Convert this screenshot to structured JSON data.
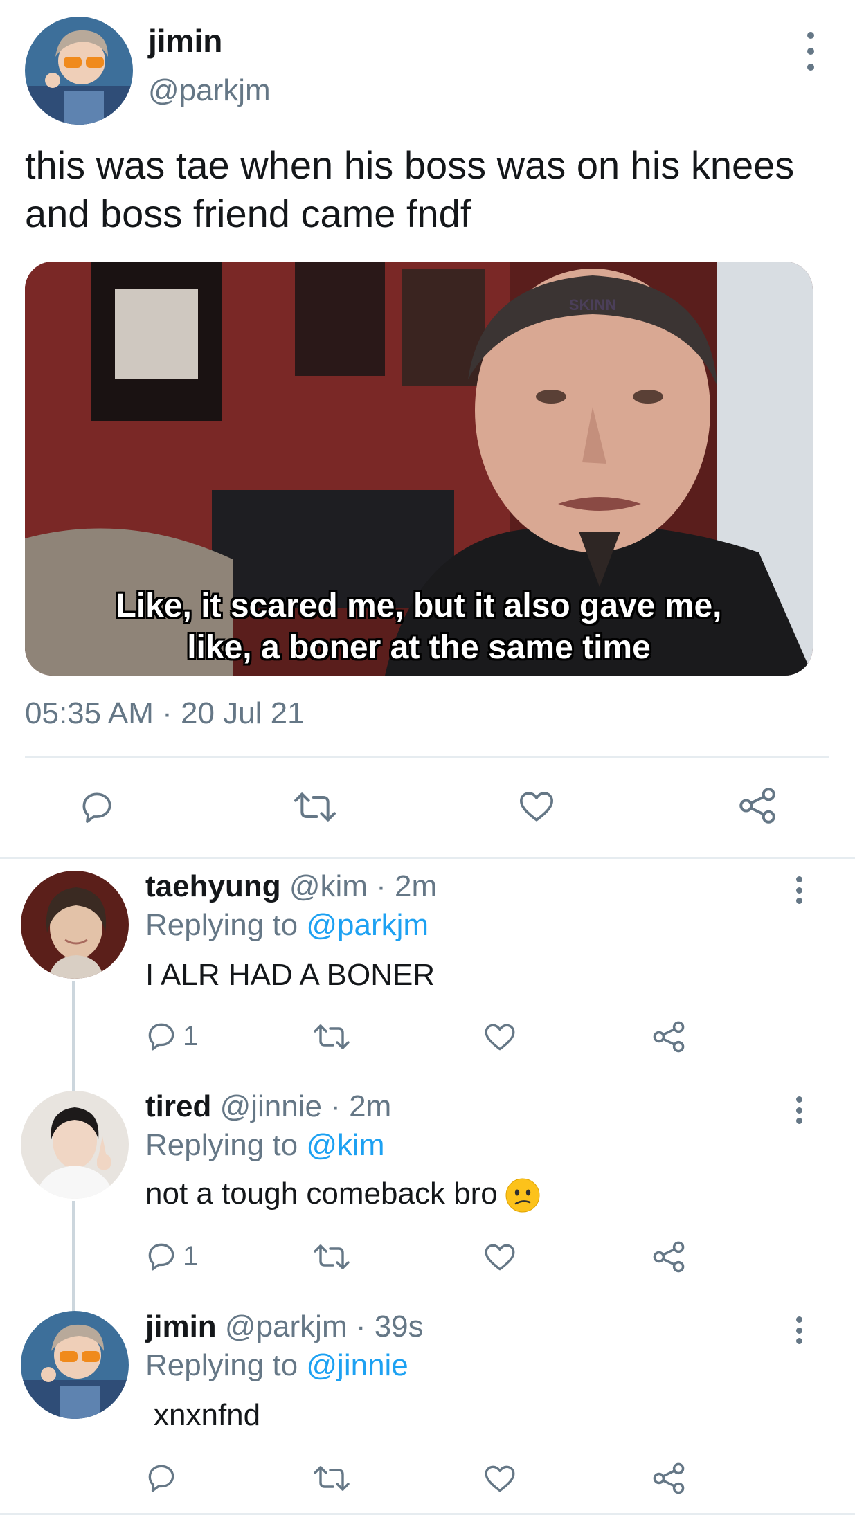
{
  "main_tweet": {
    "display_name": "jimin",
    "handle": "@parkjm",
    "text": "this was tae when his boss was on his knees and boss friend came fndf",
    "media": {
      "caption_line1": "Like, it scared me, but it also gave me,",
      "caption_line2": "like, a boner at the same time",
      "forehead_tattoo": "SKINN"
    },
    "timestamp": "05:35 AM · 20 Jul 21",
    "actions": {
      "reply_icon": "reply-bubble-icon",
      "retweet_icon": "retweet-icon",
      "like_icon": "heart-icon",
      "share_icon": "share-icon"
    }
  },
  "replies": [
    {
      "display_name": "taehyung",
      "meta": "@kim · 2m",
      "replying_label": "Replying to",
      "replying_to": "@parkjm",
      "text": "I ALR HAD A BONER",
      "reply_count": "1",
      "has_emoji": false
    },
    {
      "display_name": "tired",
      "meta": "@jinnie · 2m",
      "replying_label": "Replying to",
      "replying_to": "@kim",
      "text": "not a tough comeback bro",
      "emoji": "confused-face-emoji",
      "reply_count": "1",
      "has_emoji": true
    },
    {
      "display_name": "jimin",
      "meta": "@parkjm · 39s",
      "replying_label": "Replying to",
      "replying_to": "@jinnie",
      "text": "xnxnfnd",
      "reply_count": "",
      "has_emoji": false
    }
  ],
  "colors": {
    "text": "#14171a",
    "secondary": "#657786",
    "link": "#1da1f2",
    "divider": "#e6ecf0",
    "thread_line": "#ccd6dd"
  }
}
